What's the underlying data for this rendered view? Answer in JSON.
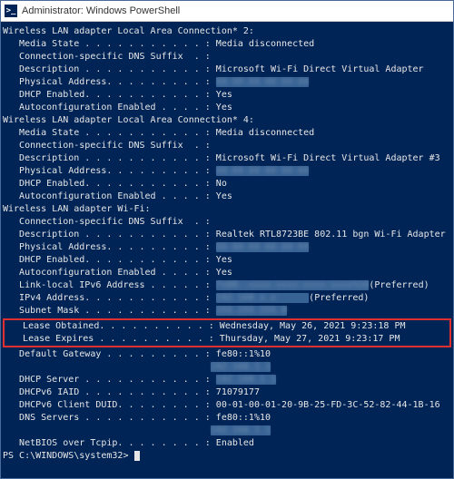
{
  "window": {
    "title": "Administrator: Windows PowerShell"
  },
  "sections": [
    {
      "heading": "Wireless LAN adapter Local Area Connection* 2:",
      "rows": [
        {
          "label": "Media State . . . . . . . . . . .",
          "value": "Media disconnected",
          "blur": false
        },
        {
          "label": "Connection-specific DNS Suffix  .",
          "value": "",
          "blur": false
        },
        {
          "label": "Description . . . . . . . . . . .",
          "value": "Microsoft Wi-Fi Direct Virtual Adapter",
          "blur": false
        },
        {
          "label": "Physical Address. . . . . . . . .",
          "value": "XX-XX-XX-XX-XX-XX",
          "blur": true
        },
        {
          "label": "DHCP Enabled. . . . . . . . . . .",
          "value": "Yes",
          "blur": false
        },
        {
          "label": "Autoconfiguration Enabled . . . .",
          "value": "Yes",
          "blur": false
        }
      ]
    },
    {
      "heading": "Wireless LAN adapter Local Area Connection* 4:",
      "rows": [
        {
          "label": "Media State . . . . . . . . . . .",
          "value": "Media disconnected",
          "blur": false
        },
        {
          "label": "Connection-specific DNS Suffix  .",
          "value": "",
          "blur": false
        },
        {
          "label": "Description . . . . . . . . . . .",
          "value": "Microsoft Wi-Fi Direct Virtual Adapter #3",
          "blur": false
        },
        {
          "label": "Physical Address. . . . . . . . .",
          "value": "XX-XX-XX-XX-XX-XX",
          "blur": true
        },
        {
          "label": "DHCP Enabled. . . . . . . . . . .",
          "value": "No",
          "blur": false
        },
        {
          "label": "Autoconfiguration Enabled . . . .",
          "value": "Yes",
          "blur": false
        }
      ]
    }
  ],
  "wifi": {
    "heading": "Wireless LAN adapter Wi-Fi:",
    "pre_rows": [
      {
        "label": "Connection-specific DNS Suffix  .",
        "value": "",
        "blur": false
      },
      {
        "label": "Description . . . . . . . . . . .",
        "value": "Realtek RTL8723BE 802.11 bgn Wi-Fi Adapter",
        "blur": false
      },
      {
        "label": "Physical Address. . . . . . . . .",
        "value": "XX-XX-XX-XX-XX-XX",
        "blur": true
      },
      {
        "label": "DHCP Enabled. . . . . . . . . . .",
        "value": "Yes",
        "blur": false
      },
      {
        "label": "Autoconfiguration Enabled . . . .",
        "value": "Yes",
        "blur": false
      }
    ],
    "link_local_row": {
      "label": "Link-local IPv6 Address . . . . .",
      "value_blur": "fe80::xxxx:xxxx:xxxx:xxxx%10",
      "suffix": "(Preferred)"
    },
    "ipv4_row": {
      "label": "IPv4 Address. . . . . . . . . . .",
      "value_blur": "192.168.x.x      ",
      "suffix": "(Preferred)"
    },
    "subnet_row": {
      "label": "Subnet Mask . . . . . . . . . . .",
      "value_blur": "255.255.255.0"
    },
    "lease_obtained": {
      "label": "Lease Obtained. . . . . . . . . .",
      "value": "Wednesday, May 26, 2021 9:23:18 PM"
    },
    "lease_expires": {
      "label": "Lease Expires . . . . . . . . . .",
      "value": "Thursday, May 27, 2021 9:23:17 PM"
    },
    "post_rows1": [
      {
        "label": "Default Gateway . . . . . . . . .",
        "value": "fe80::1%10",
        "blur": false
      }
    ],
    "gateway2": {
      "indent": "                                    ",
      "value_blur": "192.168.1.1"
    },
    "dhcp_server": {
      "label": "DHCP Server . . . . . . . . . . .",
      "value_blur": "192.168.1.1"
    },
    "post_rows2": [
      {
        "label": "DHCPv6 IAID . . . . . . . . . . .",
        "value": "71079177",
        "blur": false
      },
      {
        "label": "DHCPv6 Client DUID. . . . . . . .",
        "value": "00-01-00-01-20-9B-25-FD-3C-52-82-44-1B-16",
        "blur": false
      },
      {
        "label": "DNS Servers . . . . . . . . . . .",
        "value": "fe80::1%10",
        "blur": false
      }
    ],
    "dns2": {
      "indent": "                                    ",
      "value_blur": "192.168.1.1"
    },
    "netbios": {
      "label": "NetBIOS over Tcpip. . . . . . . .",
      "value": "Enabled"
    }
  },
  "prompt": "PS C:\\WINDOWS\\system32>"
}
